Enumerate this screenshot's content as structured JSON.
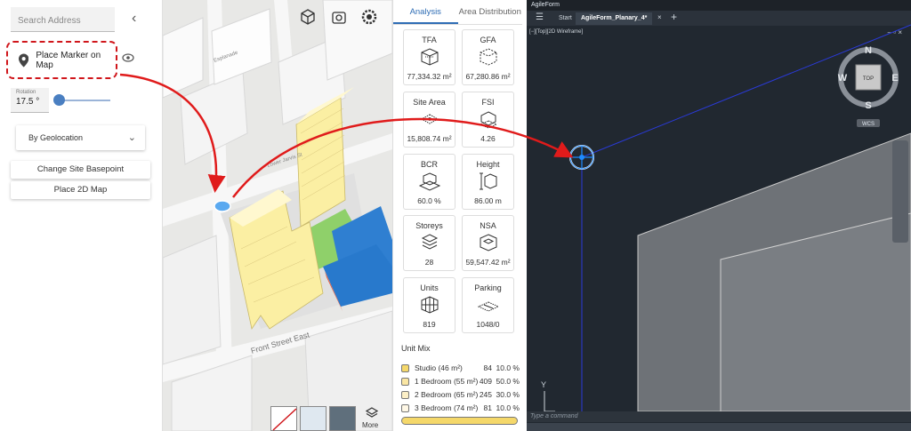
{
  "sidebar": {
    "search_placeholder": "Search Address",
    "marker_button": "Place Marker on Map",
    "rotation_label": "Rotation",
    "rotation_value": "17.5",
    "rotation_unit": "°",
    "slider_level": 0.1,
    "geo_select": "By Geolocation",
    "change_basepoint": "Change Site Basepoint",
    "place_2d_map": "Place 2D Map"
  },
  "map": {
    "street_labels": [
      "Front Street East",
      "Esplanade",
      "Lower Jarvis St"
    ],
    "more_label": "More"
  },
  "analysis": {
    "tabs": [
      {
        "label": "Analysis",
        "active": true
      },
      {
        "label": "Area Distribution",
        "active": false
      }
    ],
    "cards": [
      {
        "title": "TFA",
        "value": "77,334.32 m²",
        "icon": "tfa-cube-icon"
      },
      {
        "title": "GFA",
        "value": "67,280.86 m²",
        "icon": "gfa-cube-icon"
      },
      {
        "title": "Site Area",
        "value": "15,808.74 m²",
        "icon": "site-area-icon"
      },
      {
        "title": "FSI",
        "value": "4.26",
        "icon": "fsi-icon"
      },
      {
        "title": "BCR",
        "value": "60.0 %",
        "icon": "bcr-icon"
      },
      {
        "title": "Height",
        "value": "86.00 m",
        "icon": "height-icon"
      },
      {
        "title": "Storeys",
        "value": "28",
        "icon": "storeys-icon"
      },
      {
        "title": "NSA",
        "value": "59,547.42 m²",
        "icon": "nsa-icon"
      },
      {
        "title": "Units",
        "value": "819",
        "icon": "units-icon"
      },
      {
        "title": "Parking",
        "value": "1048/0",
        "icon": "parking-icon"
      }
    ],
    "unit_mix_title": "Unit Mix",
    "unit_mix": [
      {
        "name": "Studio (46 m²)",
        "count": "84",
        "pct": "10.0 %",
        "color": "#f5d86a"
      },
      {
        "name": "1 Bedroom (55 m²)",
        "count": "409",
        "pct": "50.0 %",
        "color": "#fae6a3"
      },
      {
        "name": "2 Bedroom (65 m²)",
        "count": "245",
        "pct": "30.0 %",
        "color": "#fcefc6"
      },
      {
        "name": "3 Bedroom (74 m²)",
        "count": "81",
        "pct": "10.0 %",
        "color": "#fff8e6"
      }
    ]
  },
  "cad": {
    "app_title": "AgileForm",
    "tab_start": "Start",
    "tab_drawing": "AgileForm_Planary_4*",
    "viewport_label": "[−][Top][2D Wireframe]",
    "compass": {
      "n": "N",
      "s": "S",
      "e": "E",
      "w": "W",
      "top": "TOP",
      "wcs": "WCS"
    },
    "axis_y": "Y",
    "command_placeholder": "Type a command"
  }
}
